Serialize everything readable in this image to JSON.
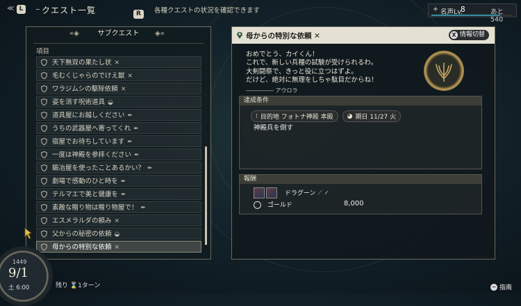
{
  "topbar": {
    "l_key": "L",
    "title": "クエスト一覧",
    "r_key": "R",
    "description": "各種クエストの状況を確認できます",
    "fame": {
      "plus": "+",
      "label": "名声Lv.",
      "level": "8",
      "remaining": "あと 540",
      "progress": 0.85
    }
  },
  "left_panel": {
    "header": "サブクエスト",
    "column_header": "項目",
    "quests": [
      {
        "title": "天下無双の果たし状",
        "status": "✕"
      },
      {
        "title": "毛むくじゃらのでけえ獣",
        "status": "✕"
      },
      {
        "title": "ワラジムシの駆除依頼",
        "status": "✕"
      },
      {
        "title": "姿を消す呪術道具",
        "status": "◒"
      },
      {
        "title": "道具屋にお越しください",
        "status": "✒"
      },
      {
        "title": "うちの武器屋へ寄ってくれ",
        "status": "✒"
      },
      {
        "title": "宿屋でお待ちしています",
        "status": "✒"
      },
      {
        "title": "一度は神殿を参拝ください",
        "status": "✒"
      },
      {
        "title": "鍛冶屋を使ったことあるかい？",
        "status": "✒"
      },
      {
        "title": "劇場で感動のひと時を",
        "status": "✒"
      },
      {
        "title": "テルマエで美と健康を",
        "status": "✒"
      },
      {
        "title": "素敵な贈り物は贈り物屋で！",
        "status": "✒"
      },
      {
        "title": "エスメラルダの頼み",
        "status": "✕"
      },
      {
        "title": "父からの秘密の依頼",
        "status": "◒"
      },
      {
        "title": "母からの特別な依頼",
        "status": "✕"
      }
    ]
  },
  "detail": {
    "title": "母からの特別な依頼",
    "title_status": "✕",
    "toggle_key": "X",
    "toggle_label": "情報切替",
    "letter": "おめでとう、カイくん！\nこれで、新しい兵種の試験が受けられるわ。\n大剣闘祭で、きっと役に立つはずよ。\nだけど、絶対に無理をしちゃ駄目だからね！",
    "signature": "――――― アウロラ",
    "conditions": {
      "header": "達成条件",
      "destination": "目的地 フォトナ神殿 本殿",
      "deadline": "期日 11/27 火",
      "description": "神殿兵を倒す"
    },
    "reward": {
      "header": "報酬",
      "unit_name": "ドラグーン",
      "unit_check": "✓",
      "gold_label": "ゴールド",
      "gold_amount": "8,000"
    }
  },
  "status": {
    "year": "1449",
    "date": "9/1",
    "time": "土 6:00",
    "turns": "残り ⌛1ターン"
  },
  "guide": {
    "key": "−",
    "label": "指南"
  }
}
